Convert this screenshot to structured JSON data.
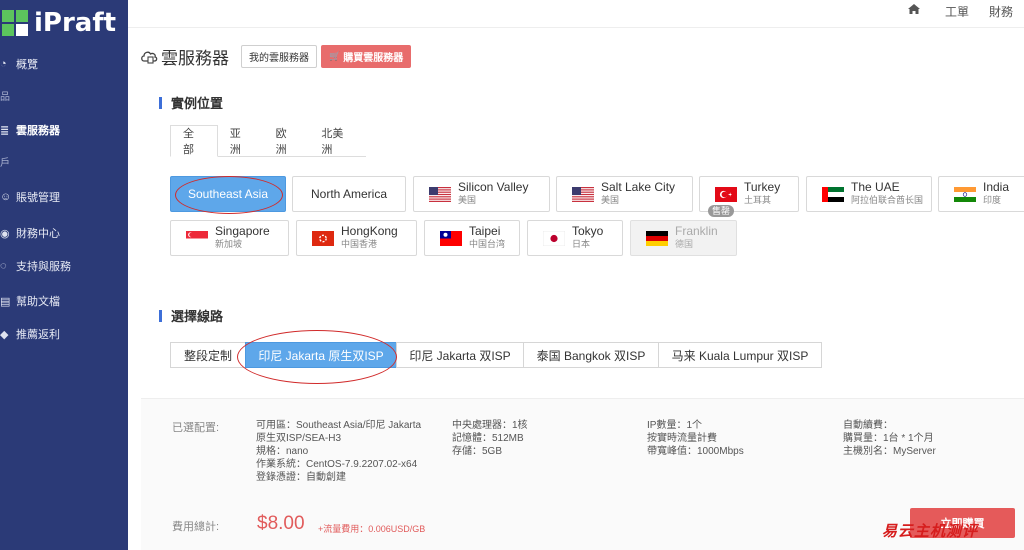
{
  "brand": {
    "logo_text": "iPraft"
  },
  "sidebar": {
    "items": [
      {
        "label": "概覽",
        "icon": "dashboard-icon",
        "active": false
      },
      {
        "label": "雲服務器",
        "icon": "server-icon",
        "active": true
      },
      {
        "label": "賬號管理",
        "icon": "user-icon",
        "active": false
      },
      {
        "label": "財務中心",
        "icon": "finance-icon",
        "active": false
      },
      {
        "label": "支持與服務",
        "icon": "support-icon",
        "active": false
      },
      {
        "label": "幫助文檔",
        "icon": "doc-icon",
        "active": false
      },
      {
        "label": "推薦返利",
        "icon": "gift-icon",
        "active": false
      }
    ],
    "fragments": [
      "品",
      "戶"
    ]
  },
  "topbar": {
    "home_icon": "home-icon",
    "ticket_label": "工單",
    "finance_label": "財務"
  },
  "header": {
    "title": "雲服務器",
    "my_servers_label": "我的雲服務器",
    "buy_label": "購買雲服務器"
  },
  "location_section": {
    "title": "實例位置",
    "tabs": [
      "全部",
      "亚洲",
      "欧洲",
      "北美洲"
    ],
    "active_tab": "全部",
    "locations": [
      {
        "name": "Southeast Asia",
        "sub": "",
        "flag": "none",
        "selected": true
      },
      {
        "name": "North America",
        "sub": "",
        "flag": "none"
      },
      {
        "name": "Silicon Valley",
        "sub": "美国",
        "flag": "us"
      },
      {
        "name": "Salt Lake City",
        "sub": "美国",
        "flag": "us"
      },
      {
        "name": "Turkey",
        "sub": "土耳其",
        "flag": "tr"
      },
      {
        "name": "The UAE",
        "sub": "阿拉伯联合酋长国",
        "flag": "ae"
      },
      {
        "name": "India",
        "sub": "印度",
        "flag": "in"
      },
      {
        "name": "Singapore",
        "sub": "新加坡",
        "flag": "sg"
      },
      {
        "name": "HongKong",
        "sub": "中国香港",
        "flag": "hk"
      },
      {
        "name": "Taipei",
        "sub": "中国台湾",
        "flag": "tw"
      },
      {
        "name": "Tokyo",
        "sub": "日本",
        "flag": "jp"
      },
      {
        "name": "Franklin",
        "sub": "德国",
        "flag": "de",
        "disabled": true,
        "badge": "售罄"
      }
    ]
  },
  "line_section": {
    "title": "選擇線路",
    "options": [
      "整段定制",
      "印尼 Jakarta 原生双ISP",
      "印尼 Jakarta 双ISP",
      "泰国 Bangkok 双ISP",
      "马来 Kuala Lumpur 双ISP"
    ],
    "selected": "印尼 Jakarta 原生双ISP"
  },
  "config": {
    "selected_label": "已選配置:",
    "col1": [
      "可用區：Southeast Asia/印尼 Jakarta",
      "原生双ISP/SEA-H3",
      "規格：nano",
      "作業系統：CentOS-7.9.2207.02-x64",
      "登錄憑證：自動創建"
    ],
    "col2": [
      "中央處理器：1核",
      "記憶體：512MB",
      "存儲：5GB"
    ],
    "col3": [
      "IP數量：1个",
      "按實時流量計費",
      "帶寬峰值：1000Mbps"
    ],
    "col4": [
      "自動續費：",
      "購買量：1台 * 1个月",
      "主機別名：MyServer"
    ],
    "total_label": "費用總計:",
    "price": "$8.00",
    "traffic_fee": "+流量費用：0.006USD/GB",
    "buy_label": "立即購買"
  },
  "watermark": "易云主机测评",
  "colors": {
    "sidebar_bg": "#2b3a77",
    "accent_blue": "#5ea7ea",
    "accent_red": "#e55a5a",
    "annotation_red": "#d12b2b"
  }
}
